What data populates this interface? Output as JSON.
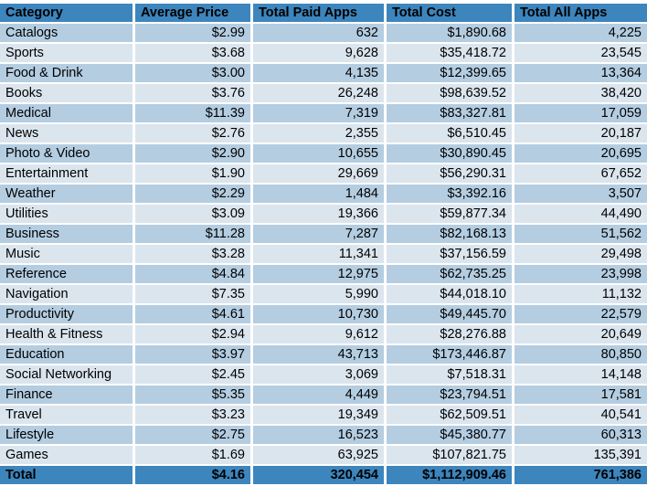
{
  "table": {
    "columns": [
      {
        "key": "category",
        "label": "Category",
        "align": "left"
      },
      {
        "key": "avg_price",
        "label": "Average Price",
        "align": "right"
      },
      {
        "key": "paid_apps",
        "label": "Total Paid Apps",
        "align": "right"
      },
      {
        "key": "total_cost",
        "label": "Total Cost",
        "align": "right"
      },
      {
        "key": "all_apps",
        "label": "Total All Apps",
        "align": "right"
      }
    ],
    "rows": [
      {
        "category": "Catalogs",
        "avg_price": "$2.99",
        "paid_apps": "632",
        "total_cost": "$1,890.68",
        "all_apps": "4,225"
      },
      {
        "category": "Sports",
        "avg_price": "$3.68",
        "paid_apps": "9,628",
        "total_cost": "$35,418.72",
        "all_apps": "23,545"
      },
      {
        "category": "Food & Drink",
        "avg_price": "$3.00",
        "paid_apps": "4,135",
        "total_cost": "$12,399.65",
        "all_apps": "13,364"
      },
      {
        "category": "Books",
        "avg_price": "$3.76",
        "paid_apps": "26,248",
        "total_cost": "$98,639.52",
        "all_apps": "38,420"
      },
      {
        "category": "Medical",
        "avg_price": "$11.39",
        "paid_apps": "7,319",
        "total_cost": "$83,327.81",
        "all_apps": "17,059"
      },
      {
        "category": "News",
        "avg_price": "$2.76",
        "paid_apps": "2,355",
        "total_cost": "$6,510.45",
        "all_apps": "20,187"
      },
      {
        "category": "Photo & Video",
        "avg_price": "$2.90",
        "paid_apps": "10,655",
        "total_cost": "$30,890.45",
        "all_apps": "20,695"
      },
      {
        "category": "Entertainment",
        "avg_price": "$1.90",
        "paid_apps": "29,669",
        "total_cost": "$56,290.31",
        "all_apps": "67,652"
      },
      {
        "category": "Weather",
        "avg_price": "$2.29",
        "paid_apps": "1,484",
        "total_cost": "$3,392.16",
        "all_apps": "3,507"
      },
      {
        "category": "Utilities",
        "avg_price": "$3.09",
        "paid_apps": "19,366",
        "total_cost": "$59,877.34",
        "all_apps": "44,490"
      },
      {
        "category": "Business",
        "avg_price": "$11.28",
        "paid_apps": "7,287",
        "total_cost": "$82,168.13",
        "all_apps": "51,562"
      },
      {
        "category": "Music",
        "avg_price": "$3.28",
        "paid_apps": "11,341",
        "total_cost": "$37,156.59",
        "all_apps": "29,498"
      },
      {
        "category": "Reference",
        "avg_price": "$4.84",
        "paid_apps": "12,975",
        "total_cost": "$62,735.25",
        "all_apps": "23,998"
      },
      {
        "category": "Navigation",
        "avg_price": "$7.35",
        "paid_apps": "5,990",
        "total_cost": "$44,018.10",
        "all_apps": "11,132"
      },
      {
        "category": "Productivity",
        "avg_price": "$4.61",
        "paid_apps": "10,730",
        "total_cost": "$49,445.70",
        "all_apps": "22,579"
      },
      {
        "category": "Health & Fitness",
        "avg_price": "$2.94",
        "paid_apps": "9,612",
        "total_cost": "$28,276.88",
        "all_apps": "20,649"
      },
      {
        "category": "Education",
        "avg_price": "$3.97",
        "paid_apps": "43,713",
        "total_cost": "$173,446.87",
        "all_apps": "80,850"
      },
      {
        "category": "Social Networking",
        "avg_price": "$2.45",
        "paid_apps": "3,069",
        "total_cost": "$7,518.31",
        "all_apps": "14,148"
      },
      {
        "category": "Finance",
        "avg_price": "$5.35",
        "paid_apps": "4,449",
        "total_cost": "$23,794.51",
        "all_apps": "17,581"
      },
      {
        "category": "Travel",
        "avg_price": "$3.23",
        "paid_apps": "19,349",
        "total_cost": "$62,509.51",
        "all_apps": "40,541"
      },
      {
        "category": "Lifestyle",
        "avg_price": "$2.75",
        "paid_apps": "16,523",
        "total_cost": "$45,380.77",
        "all_apps": "60,313"
      },
      {
        "category": "Games",
        "avg_price": "$1.69",
        "paid_apps": "63,925",
        "total_cost": "$107,821.75",
        "all_apps": "135,391"
      }
    ],
    "total_row": {
      "category": "Total",
      "avg_price": "$4.16",
      "paid_apps": "320,454",
      "total_cost": "$1,112,909.46",
      "all_apps": "761,386"
    }
  },
  "colors": {
    "header_blue": "#3d85bd",
    "row_dark": "#b4cde1",
    "row_light": "#dbe5ee",
    "gridline": "#ffffff",
    "text": "#000000",
    "header_text": "#ffffff"
  }
}
